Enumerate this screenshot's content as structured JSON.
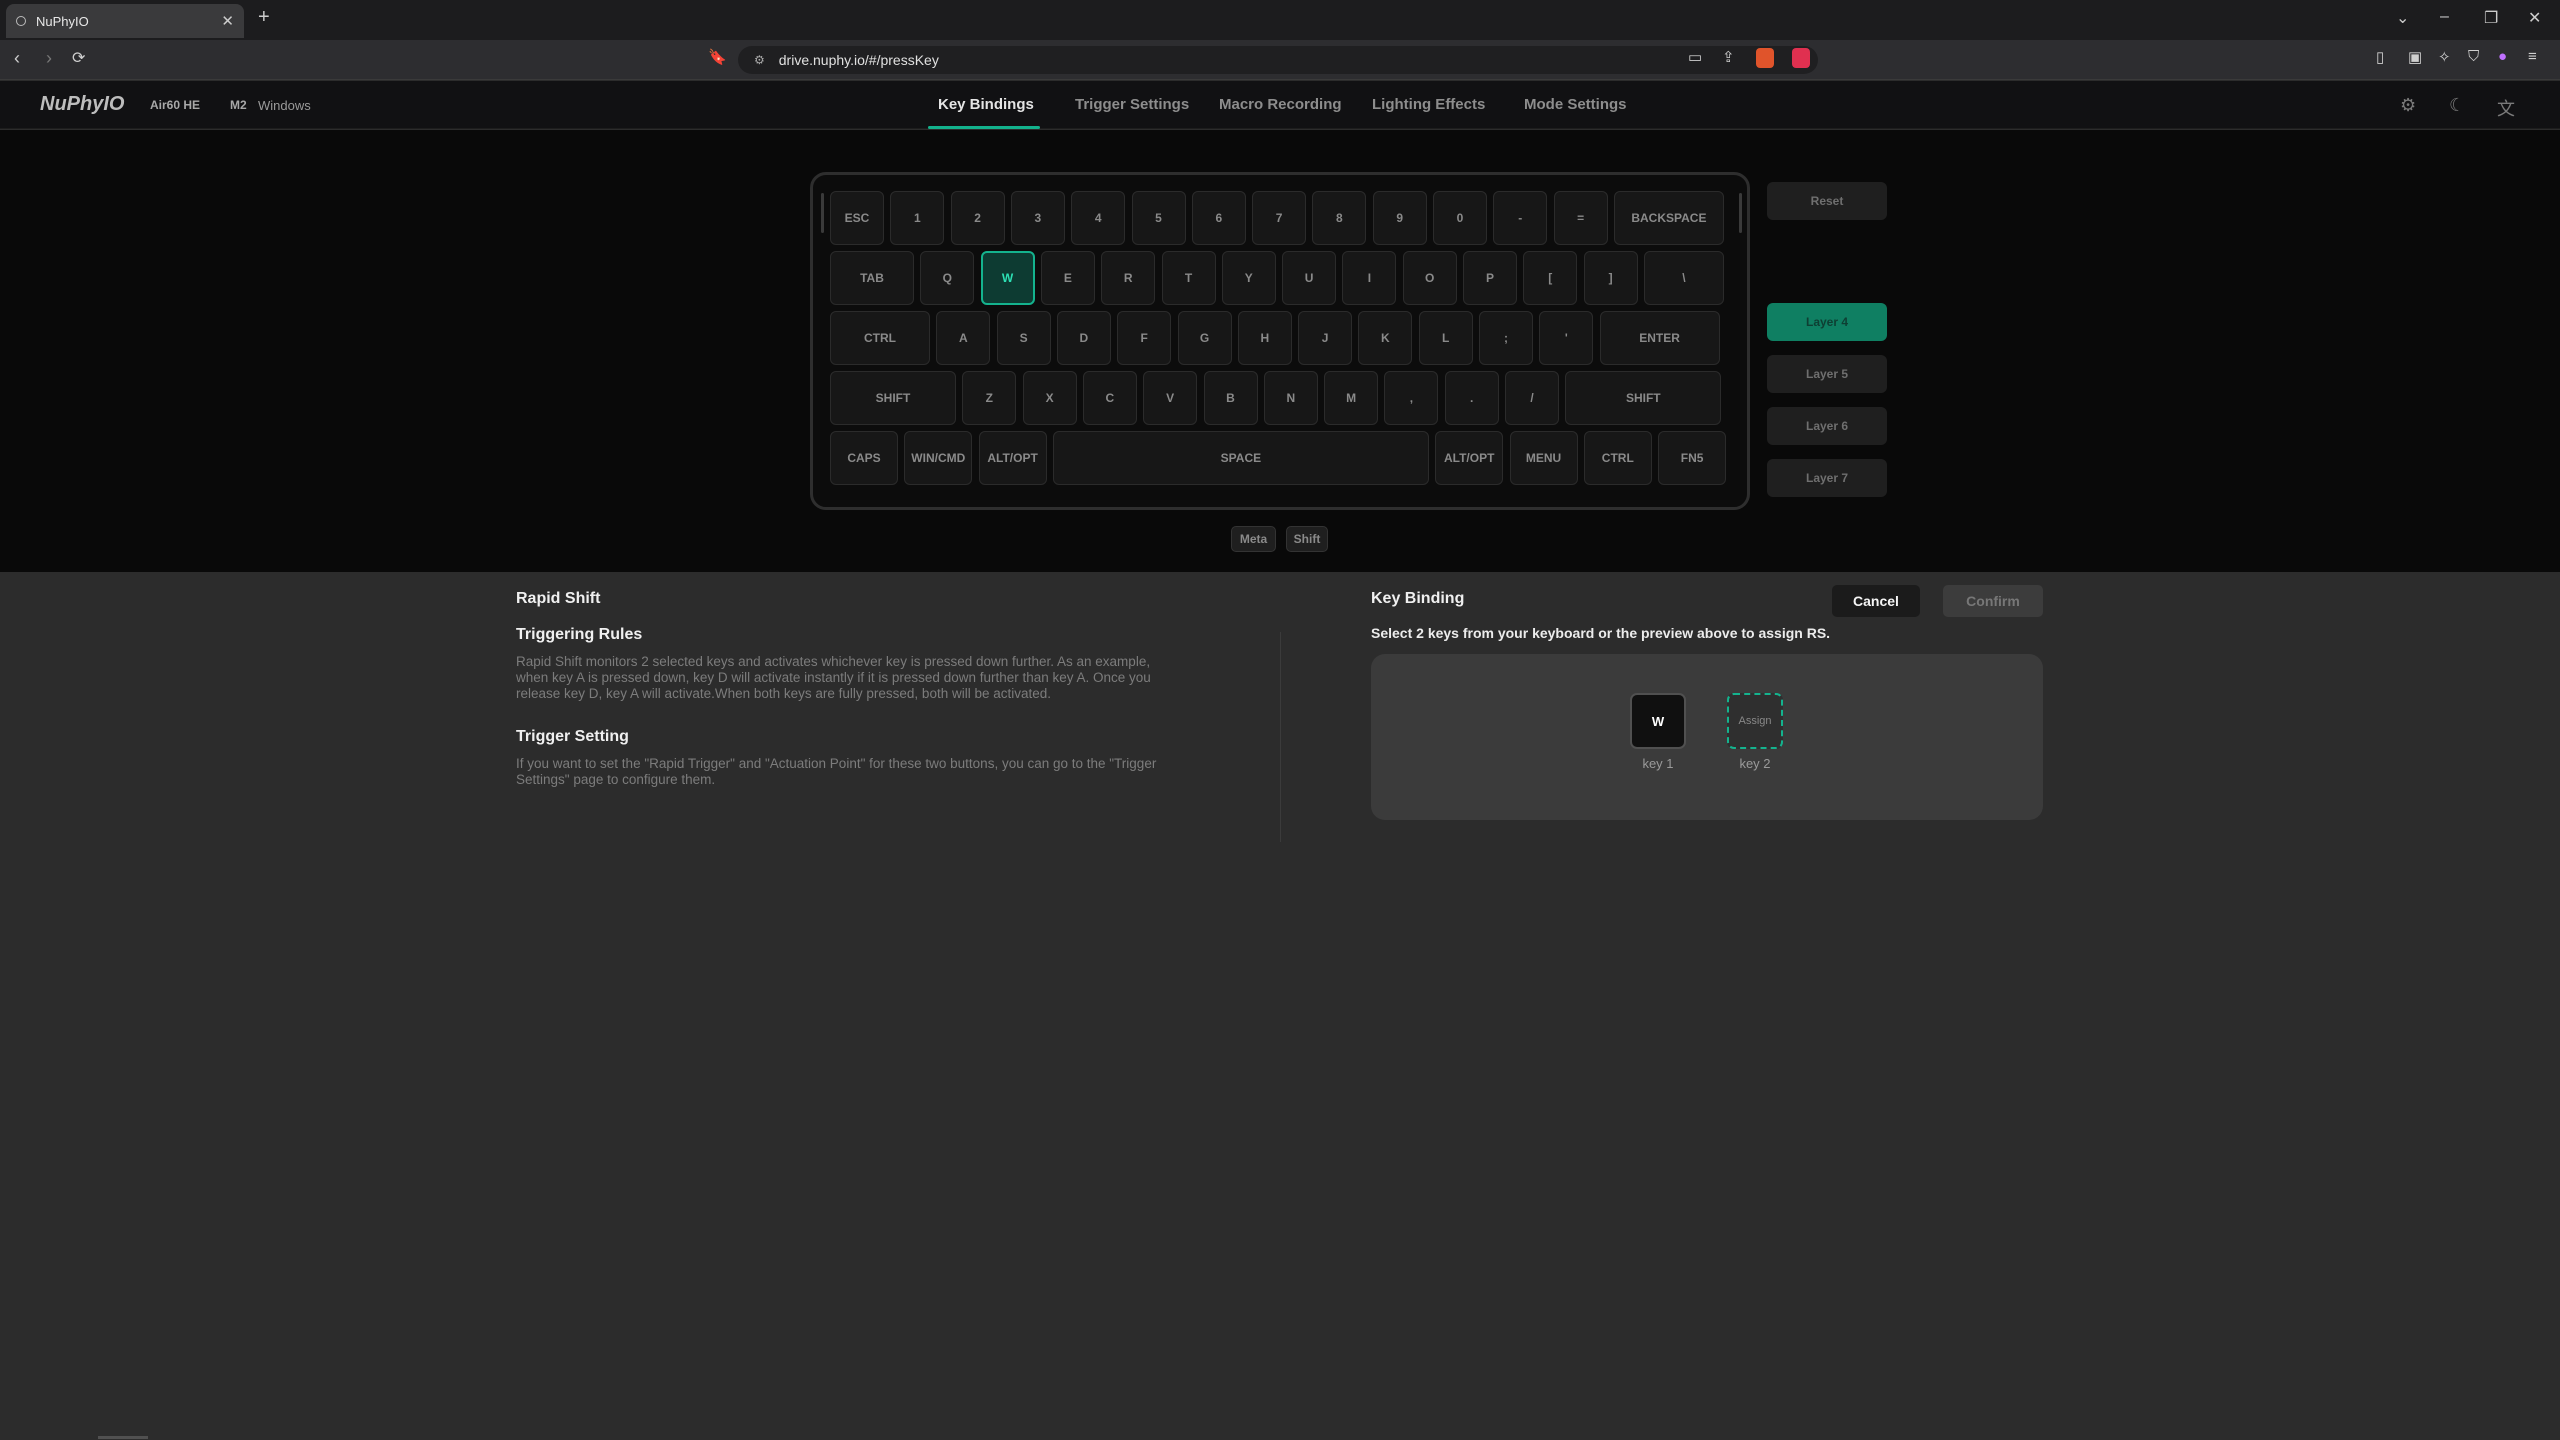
{
  "browser": {
    "tab_title": "NuPhyIO",
    "url": "drive.nuphy.io/#/pressKey"
  },
  "app": {
    "logo": "NuPhyIO",
    "device": "Air60 HE",
    "profile": "M2",
    "os": "Windows",
    "nav": [
      "Key Bindings",
      "Trigger Settings",
      "Macro Recording",
      "Lighting Effects",
      "Mode Settings"
    ],
    "active_nav": "Key Bindings"
  },
  "keyboard": {
    "rows": [
      [
        "ESC",
        "1",
        "2",
        "3",
        "4",
        "5",
        "6",
        "7",
        "8",
        "9",
        "0",
        "-",
        "=",
        "BACKSPACE"
      ],
      [
        "TAB",
        "Q",
        "W",
        "E",
        "R",
        "T",
        "Y",
        "U",
        "I",
        "O",
        "P",
        "[",
        "]",
        "\\"
      ],
      [
        "CTRL",
        "A",
        "S",
        "D",
        "F",
        "G",
        "H",
        "J",
        "K",
        "L",
        ";",
        "'",
        "ENTER"
      ],
      [
        "SHIFT",
        "Z",
        "X",
        "C",
        "V",
        "B",
        "N",
        "M",
        ",",
        ".",
        "/",
        "SHIFT"
      ],
      [
        "CAPS",
        "WIN/CMD",
        "ALT/OPT",
        "SPACE",
        "ALT/OPT",
        "MENU",
        "CTRL",
        "FN5"
      ]
    ],
    "selected_key": "W"
  },
  "side": {
    "reset": "Reset",
    "layers": [
      "Layer 4",
      "Layer 5",
      "Layer 6",
      "Layer 7"
    ],
    "active_layer": "Layer 4"
  },
  "modifiers": [
    "Meta",
    "Shift"
  ],
  "panel": {
    "title": "Rapid Shift",
    "rules_title": "Triggering Rules",
    "rules_text": "Rapid Shift monitors 2 selected keys and activates whichever key is pressed down further. As an example, when key A is pressed down, key D will activate instantly if it is pressed down further than key A. Once you release key D, key A will activate.When both keys are fully pressed, both will be activated.",
    "setting_title": "Trigger Setting",
    "setting_text": "If you want to set the \"Rapid Trigger\" and \"Actuation Point\" for these two buttons, you can go to the \"Trigger Settings\" page to configure them.",
    "binding_title": "Key Binding",
    "instruction": "Select 2 keys from your keyboard or the preview above to assign RS.",
    "cancel": "Cancel",
    "confirm": "Confirm",
    "key1_value": "W",
    "key1_label": "key 1",
    "key2_value": "Assign",
    "key2_label": "key 2"
  }
}
